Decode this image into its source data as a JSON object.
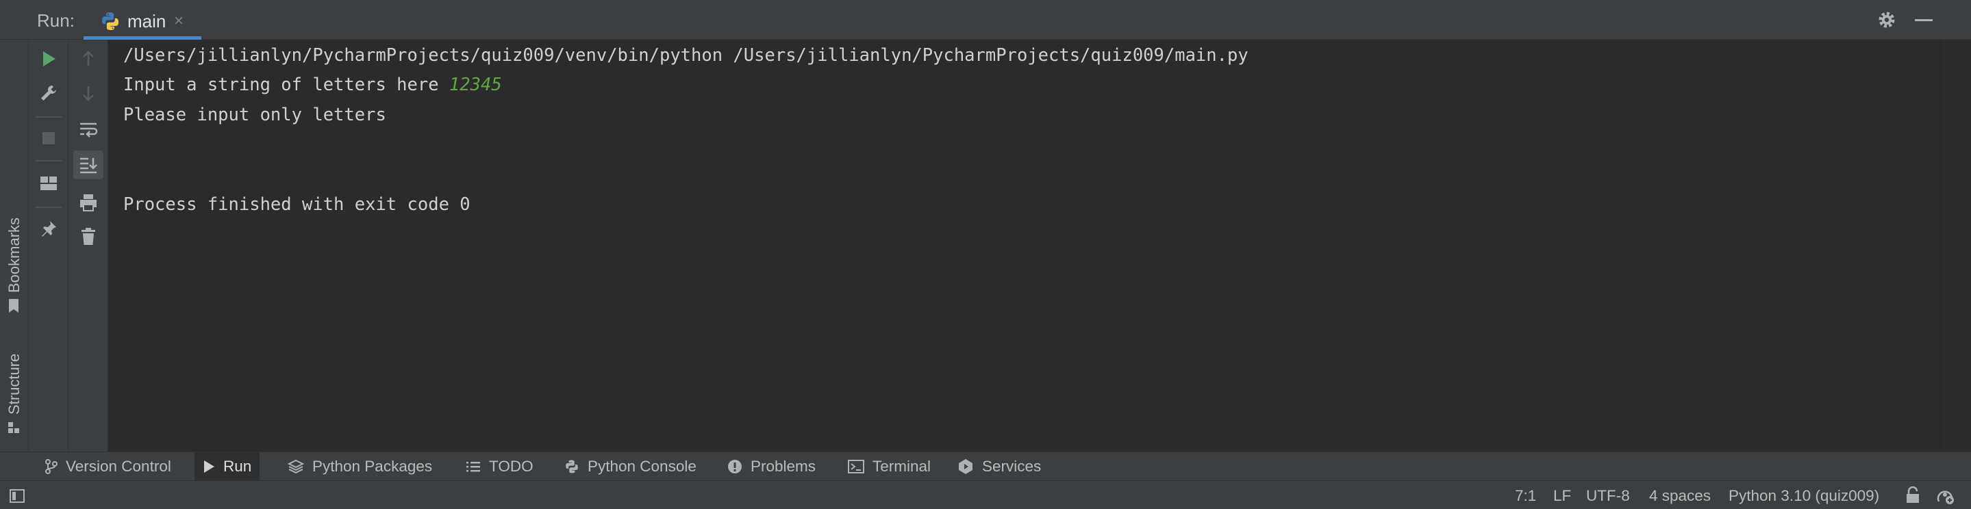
{
  "run_panel": {
    "label": "Run:",
    "tab": {
      "label": "main",
      "close": "×"
    }
  },
  "left_strip": {
    "bookmarks": "Bookmarks",
    "structure": "Structure"
  },
  "console": {
    "lines": [
      "/Users/jillianlyn/PycharmProjects/quiz009/venv/bin/python /Users/jillianlyn/PycharmProjects/quiz009/main.py",
      "Input a string of letters here ",
      "Please input only letters",
      "Process finished with exit code 0"
    ],
    "user_input": "12345",
    "input_color": "#5fa842"
  },
  "bottom_tabs": [
    {
      "label": "Version Control",
      "icon": "branch-icon"
    },
    {
      "label": "Run",
      "icon": "run-icon",
      "active": true
    },
    {
      "label": "Python Packages",
      "icon": "layers-icon"
    },
    {
      "label": "TODO",
      "icon": "list-icon"
    },
    {
      "label": "Python Console",
      "icon": "python-icon"
    },
    {
      "label": "Problems",
      "icon": "info-icon"
    },
    {
      "label": "Terminal",
      "icon": "terminal-icon"
    },
    {
      "label": "Services",
      "icon": "services-icon"
    }
  ],
  "status_bar": {
    "position": "7:1",
    "line_separator": "LF",
    "encoding": "UTF-8",
    "indent": "4 spaces",
    "interpreter": "Python 3.10 (quiz009)"
  },
  "colors": {
    "accent": "#4a88c7",
    "run_green": "#59a869",
    "panel_bg": "#3c3f41",
    "editor_bg": "#2b2b2b"
  }
}
